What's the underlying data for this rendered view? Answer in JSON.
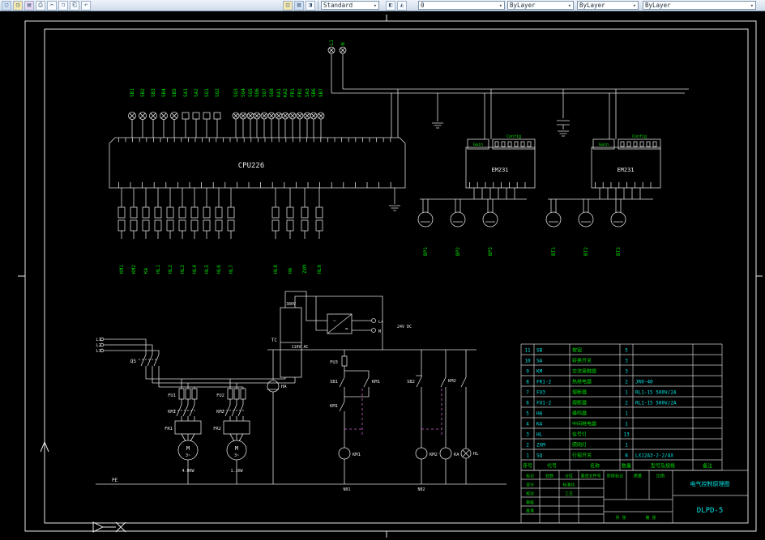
{
  "toolbar": {
    "dropdown_arrow": "▾",
    "icons_left": [
      {
        "name": "new",
        "glyph": "▢"
      },
      {
        "name": "open",
        "glyph": "◳"
      },
      {
        "name": "save",
        "glyph": "▤"
      },
      {
        "name": "print",
        "glyph": "⎙"
      },
      {
        "name": "cut",
        "glyph": "✂"
      },
      {
        "name": "copy",
        "glyph": "❐"
      },
      {
        "name": "paste",
        "glyph": "⎗"
      },
      {
        "name": "undo",
        "glyph": "↶"
      }
    ],
    "icons_mid": [
      {
        "name": "layer-manager",
        "glyph": "◫"
      },
      {
        "name": "layer-states",
        "glyph": "▥"
      },
      {
        "name": "color-picker",
        "glyph": "◨"
      }
    ],
    "icons_mid2": [
      {
        "name": "make-current",
        "glyph": "◧"
      },
      {
        "name": "layer-previous",
        "glyph": "◭"
      }
    ],
    "combos": [
      {
        "name": "text-style",
        "value": "Standard"
      },
      {
        "name": "layer",
        "value": "0"
      },
      {
        "name": "color",
        "value": "ByLayer"
      },
      {
        "name": "linetype",
        "value": "ByLayer"
      },
      {
        "name": "lineweight",
        "value": "ByLayer"
      }
    ]
  },
  "plc": {
    "cpu_label": "CPU226",
    "em1_label": "EM231",
    "em2_label": "EM231",
    "gain": "Gain",
    "config": "Config",
    "power_terminal_labels": [
      "L1",
      "N"
    ],
    "input_labels_left": [
      "SB1",
      "SB2",
      "SB3",
      "SB4",
      "SB5",
      "SA1",
      "SA2",
      "SQ1",
      "SQ2"
    ],
    "input_labels_right": [
      "SQ3",
      "SQ4",
      "SQ5",
      "SQ6",
      "SQ7",
      "SQ8",
      "KA1",
      "KA2",
      "FR1",
      "FR2",
      "SA3",
      "SB6",
      "SB7"
    ],
    "output_labels": [
      "KM1",
      "KM2",
      "KA",
      "HL1",
      "HL2",
      "HL3",
      "HL4",
      "HL5",
      "HL6",
      "HL7",
      "HL8",
      "HA",
      "ZXM",
      "HL9"
    ],
    "sensor_labels": [
      "BP1",
      "BP2",
      "BP3",
      "BT1",
      "BT2",
      "BT3"
    ]
  },
  "motor": {
    "l1": "L1",
    "l2": "L2",
    "l3": "L3",
    "qs": "QS",
    "fu1": "FU1",
    "fu2": "FU2",
    "fu3": "FU3",
    "km1": "KM1",
    "km2": "KM2",
    "fr1": "FR1",
    "fr2": "FR2",
    "m": "M",
    "phase": "3~",
    "m1_rating": "4.0KW",
    "m2_rating": "1.1KW",
    "tc": "TC",
    "v380": "380V",
    "v110": "110V AC",
    "pe": "PE",
    "sb1": "SB1",
    "sb2": "SB2",
    "km1_seal": "KM1",
    "km2_aux": "KM2",
    "coil_km1": "KM1",
    "coil_km2": "KM2",
    "coil_ka": "KA",
    "hl": "HL",
    "ha": "HA",
    "lplus": "L+",
    "mneg": "M",
    "dc": "24V DC",
    "ac_sym": "~",
    "dc_sym": "=",
    "n01": "N01",
    "n02": "N02"
  },
  "bom": {
    "headers": [
      "序号",
      "代号",
      "名称",
      "数量",
      "型号及规格",
      "备注"
    ],
    "rows": [
      {
        "no": "11",
        "code": "SB",
        "name": "按钮",
        "qty": "5",
        "spec": ""
      },
      {
        "no": "10",
        "code": "SA",
        "name": "转换开关",
        "qty": "3",
        "spec": ""
      },
      {
        "no": "9",
        "code": "KM",
        "name": "交流接触器",
        "qty": "3",
        "spec": ""
      },
      {
        "no": "8",
        "code": "FR1-2",
        "name": "热继电器",
        "qty": "2",
        "spec": "JR0-40"
      },
      {
        "no": "7",
        "code": "FU3",
        "name": "熔断器",
        "qty": "1",
        "spec": "RL1-15 500V/2A"
      },
      {
        "no": "6",
        "code": "FU1-2",
        "name": "熔断器",
        "qty": "2",
        "spec": "RL1-15 500V/2A"
      },
      {
        "no": "5",
        "code": "HA",
        "name": "蜂鸣器",
        "qty": "1",
        "spec": ""
      },
      {
        "no": "4",
        "code": "KA",
        "name": "中间继电器",
        "qty": "1",
        "spec": ""
      },
      {
        "no": "3",
        "code": "HL",
        "name": "信号灯",
        "qty": "13",
        "spec": ""
      },
      {
        "no": "2",
        "code": "ZXM",
        "name": "照明灯",
        "qty": "1",
        "spec": ""
      },
      {
        "no": "1",
        "code": "SQ",
        "name": "行程开关",
        "qty": "8",
        "spec": "LX12A3-2-2/AX"
      }
    ]
  },
  "title_block": {
    "title": "电气控制原理图",
    "drawing_no": "DLPD-5",
    "labels": {
      "mark": "标记",
      "count": "处数",
      "zone": "分区",
      "file": "更改文件号",
      "design": "设计",
      "check": "校对",
      "review": "审核",
      "approve": "批准",
      "std": "标准化",
      "process": "工艺",
      "stage": "阶段标记",
      "weight": "质量",
      "scale": "比例",
      "sheet": "共 张",
      "page": "第 张"
    }
  }
}
